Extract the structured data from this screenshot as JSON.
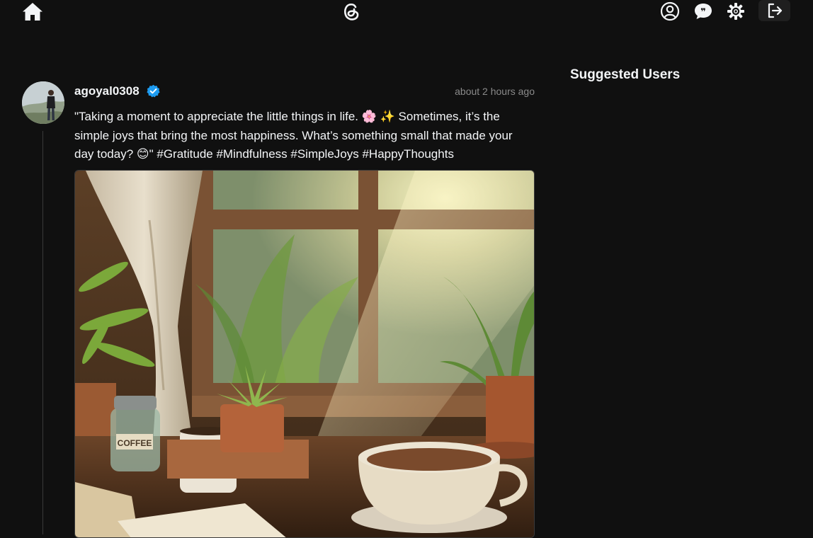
{
  "nav": {
    "home_icon": "home-icon",
    "logo_icon": "threads-logo-icon",
    "profile_icon": "user-circle-icon",
    "chat_icon": "chat-bubble-icon",
    "settings_icon": "gear-icon",
    "logout_icon": "logout-icon"
  },
  "post": {
    "username": "agoyal0308",
    "verified": true,
    "timestamp": "about 2 hours ago",
    "text": "\"Taking a moment to appreciate the little things in life. 🌸 ✨ Sometimes, it’s the simple joys that bring the most happiness. What’s something small that made your day today? 😊\" #Gratitude #Mindfulness #SimpleJoys #HappyThoughts",
    "image_alt": "COFFEE"
  },
  "sidebar": {
    "title": "Suggested Users"
  },
  "colors": {
    "background": "#101010",
    "text": "#f3f5f7",
    "muted": "#8a8a8a",
    "verified": "#1d9bf0"
  }
}
